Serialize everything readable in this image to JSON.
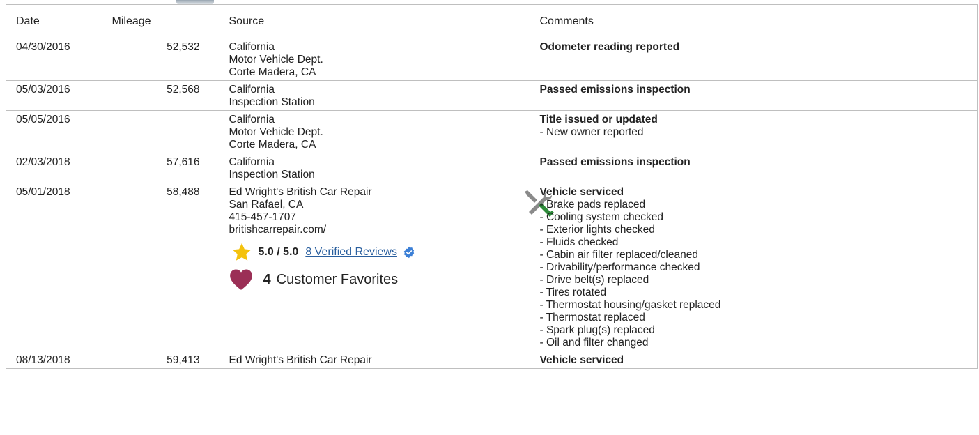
{
  "columns": {
    "date": "Date",
    "mileage": "Mileage",
    "source": "Source",
    "comments": "Comments"
  },
  "rows": [
    {
      "date": "04/30/2016",
      "mileage": "52,532",
      "source": [
        "California",
        "Motor Vehicle Dept.",
        "Corte Madera, CA"
      ],
      "comment_title": "Odometer reading reported",
      "comment_items": []
    },
    {
      "date": "05/03/2016",
      "mileage": "52,568",
      "source": [
        "California",
        "Inspection Station"
      ],
      "comment_title": "Passed emissions inspection",
      "comment_items": []
    },
    {
      "date": "05/05/2016",
      "mileage": "",
      "source": [
        "California",
        "Motor Vehicle Dept.",
        "Corte Madera, CA"
      ],
      "comment_title": "Title issued or updated",
      "comment_items": [
        "- New owner reported"
      ]
    },
    {
      "date": "02/03/2018",
      "mileage": "57,616",
      "source": [
        "California",
        "Inspection Station"
      ],
      "comment_title": "Passed emissions inspection",
      "comment_items": []
    },
    {
      "date": "05/01/2018",
      "mileage": "58,488",
      "source": [
        "Ed Wright's British Car Repair",
        "San Rafael, CA",
        "415-457-1707",
        "britishcarrepair.com/"
      ],
      "rating": {
        "score": "5.0 / 5.0",
        "reviews_link": "8 Verified Reviews"
      },
      "favorites": {
        "count": "4",
        "label": "Customer Favorites"
      },
      "service_icon": "wrench-screwdriver-icon",
      "comment_title": "Vehicle serviced",
      "comment_items": [
        "- Brake pads replaced",
        "- Cooling system checked",
        "- Exterior lights checked",
        "- Fluids checked",
        "- Cabin air filter replaced/cleaned",
        "- Drivability/performance checked",
        "- Drive belt(s) replaced",
        "- Tires rotated",
        "- Thermostat housing/gasket replaced",
        "- Thermostat replaced",
        "- Spark plug(s) replaced",
        "- Oil and filter changed"
      ]
    },
    {
      "date": "08/13/2018",
      "mileage": "59,413",
      "source": [
        "Ed Wright's British Car Repair"
      ],
      "comment_title": "Vehicle serviced",
      "comment_items": []
    }
  ],
  "colors": {
    "star": "#f4c20d",
    "heart": "#9b2f56",
    "link": "#2a5f9e",
    "badge": "#3b7fd6",
    "wrench": "#8a8a8a",
    "screwdriver": "#2e8b3a"
  }
}
